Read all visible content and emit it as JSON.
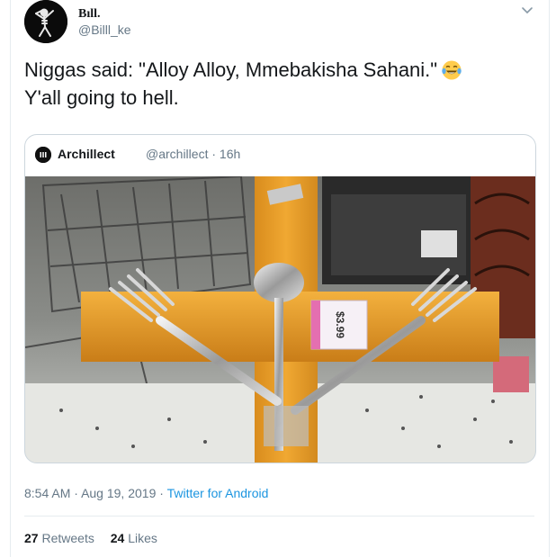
{
  "author": {
    "name": "Bıll.",
    "handle": "@Billl_ke"
  },
  "tweet": {
    "line1": "Niggas said: \"Alloy Alloy, Mmebakisha Sahani.\"",
    "line2": "Y'all going to hell.",
    "emoji": "face-with-tears-of-joy-icon"
  },
  "quoted": {
    "name": "Archillect",
    "handle": "@archillect",
    "separator": "·",
    "age": "16h",
    "photo": {
      "price_tag": "$3.99",
      "icon": "photo-cross-made-of-forks-and-spoon"
    }
  },
  "meta": {
    "time": "8:54 AM",
    "separator1": "·",
    "date": "Aug 19, 2019",
    "separator2": "·",
    "source": "Twitter for Android"
  },
  "stats": {
    "retweets_count": "27",
    "retweets_label": "Retweets",
    "likes_count": "24",
    "likes_label": "Likes"
  },
  "colors": {
    "link": "#1b95e0",
    "secondary_text": "#657786",
    "primary_text": "#14171a",
    "border": "#e6ecf0"
  }
}
